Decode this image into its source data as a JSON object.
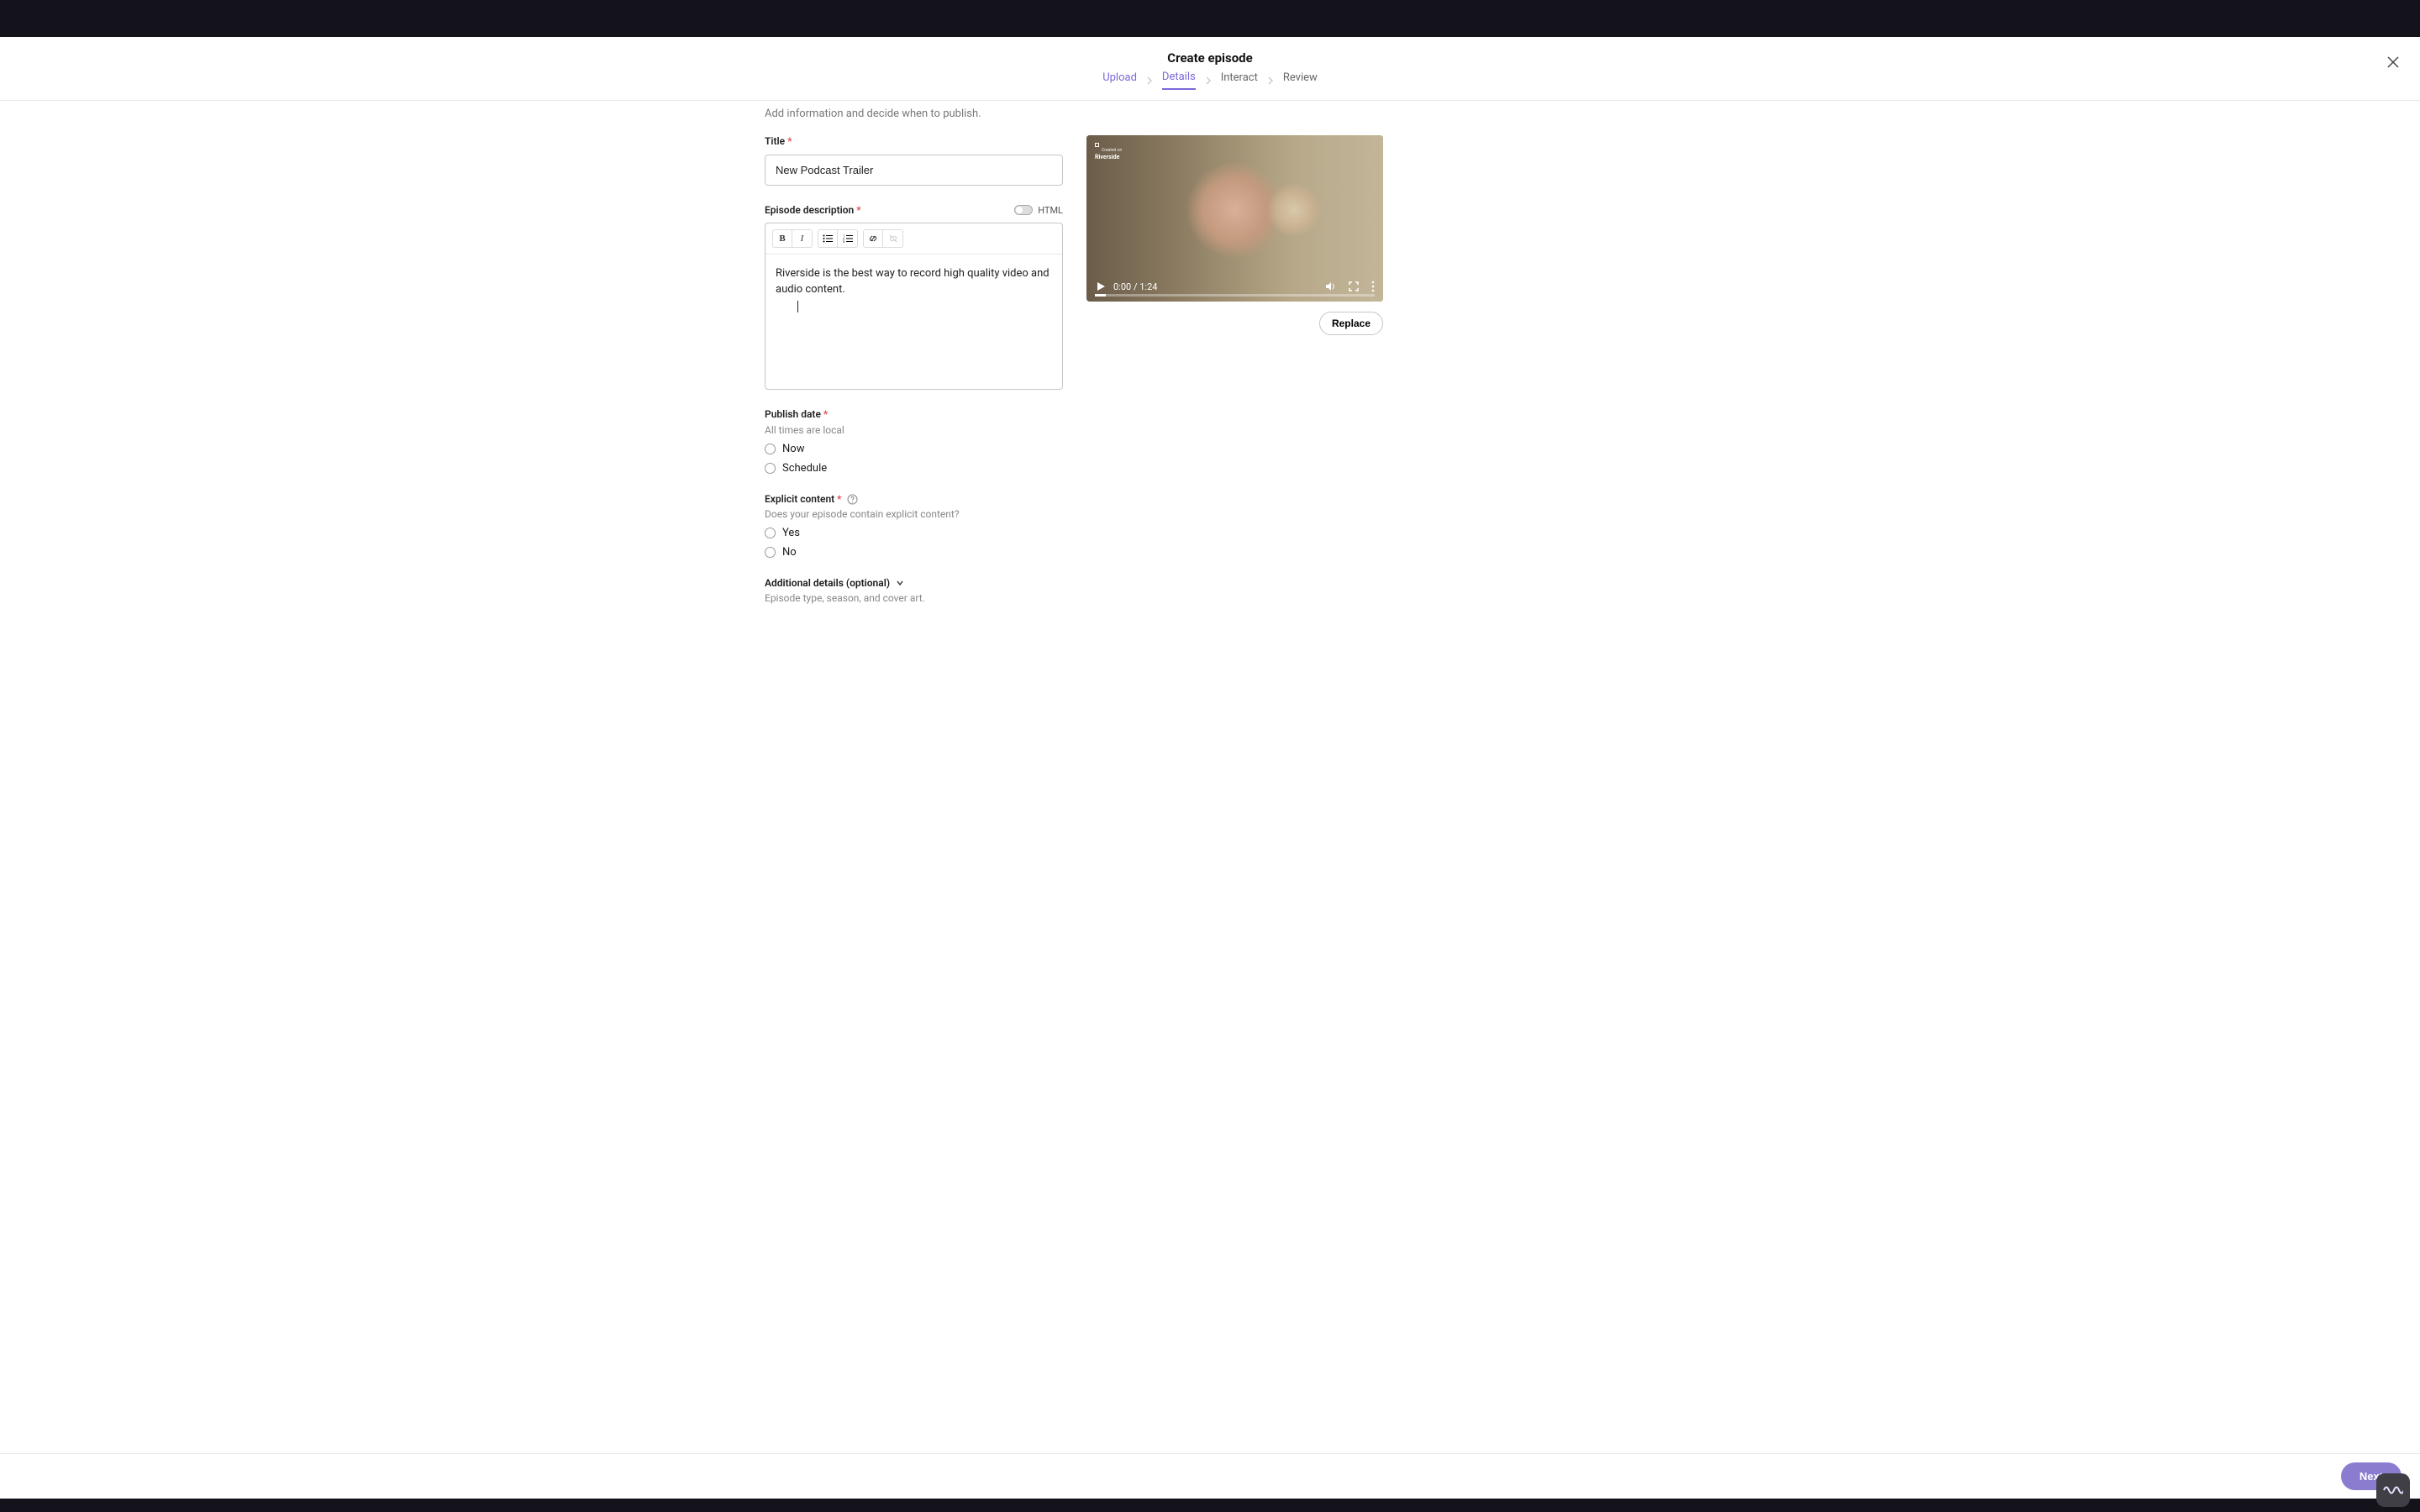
{
  "header": {
    "page_title": "Create episode",
    "steps": [
      "Upload",
      "Details",
      "Interact",
      "Review"
    ]
  },
  "subtitle": "Add information and decide when to publish.",
  "title_section": {
    "label": "Title",
    "value": "New Podcast Trailer"
  },
  "description_section": {
    "label": "Episode description",
    "toggle_label": "HTML",
    "content": "Riverside is the best way to record high quality video and audio content."
  },
  "publish_date_section": {
    "label": "Publish date",
    "helper": "All times are local",
    "options": [
      "Now",
      "Schedule"
    ]
  },
  "explicit_section": {
    "label": "Explicit content",
    "helper": "Does your episode contain explicit content?",
    "options": [
      "Yes",
      "No"
    ]
  },
  "additional_section": {
    "label": "Additional details (optional)",
    "helper": "Episode type, season, and cover art."
  },
  "media": {
    "watermark_top": "Created on",
    "watermark_bottom": "Riverside",
    "current_time": "0:00",
    "duration": "1:24",
    "time_sep": " / ",
    "replace_label": "Replace"
  },
  "footer": {
    "next_label": "Next"
  }
}
